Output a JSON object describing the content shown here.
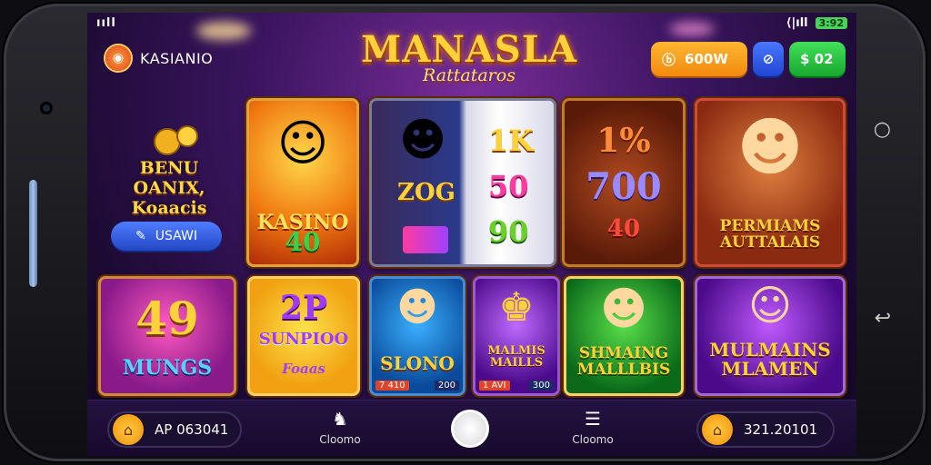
{
  "status_bar": {
    "left": "ııll",
    "signal": "⟨|ıll",
    "battery": "3:92"
  },
  "brand": {
    "name": "KASIANIO",
    "logo_icon": "chip-icon"
  },
  "title": {
    "main": "MANASLA",
    "sub": "Rattataros"
  },
  "top_buttons": {
    "orange_label": "600W",
    "green_label": "$ 02"
  },
  "promo": {
    "text_line1": "BENU OANIX,",
    "text_line2": "Koaacis",
    "button_label": "USAWI"
  },
  "tiles": [
    {
      "label": "KASINO",
      "badge": "40"
    },
    {
      "label": "ZOG",
      "values": [
        "1K",
        "50",
        "90"
      ]
    },
    {
      "label": "700",
      "values": [
        "1%",
        "700",
        "40"
      ]
    },
    {
      "label": "PERMIAMS AUTTALAIS"
    },
    {
      "label_big": "49",
      "label": "MUNGS"
    },
    {
      "label_big": "2P",
      "label": "SUNPIOO",
      "sub": "Foaas"
    },
    {
      "label": "SLONO",
      "badge_left": "7 410",
      "badge_right": "200"
    },
    {
      "label": "MALMIS MAILLS",
      "badge_left": "1 AVI",
      "badge_right": "300"
    },
    {
      "label": "SHMAING MALLLBIS"
    },
    {
      "label": "MULMAINS MLAMEN"
    }
  ],
  "bottom_nav": {
    "left_pill": "AP 063041",
    "item1": "Cloomo",
    "item2": "Cloomo",
    "right_pill": "321.20101"
  },
  "colors": {
    "accent_orange": "#f28a10",
    "accent_blue": "#2447c4",
    "accent_green": "#18a82f",
    "gold": "#ffd23a",
    "bg_purple": "#3b1560"
  }
}
